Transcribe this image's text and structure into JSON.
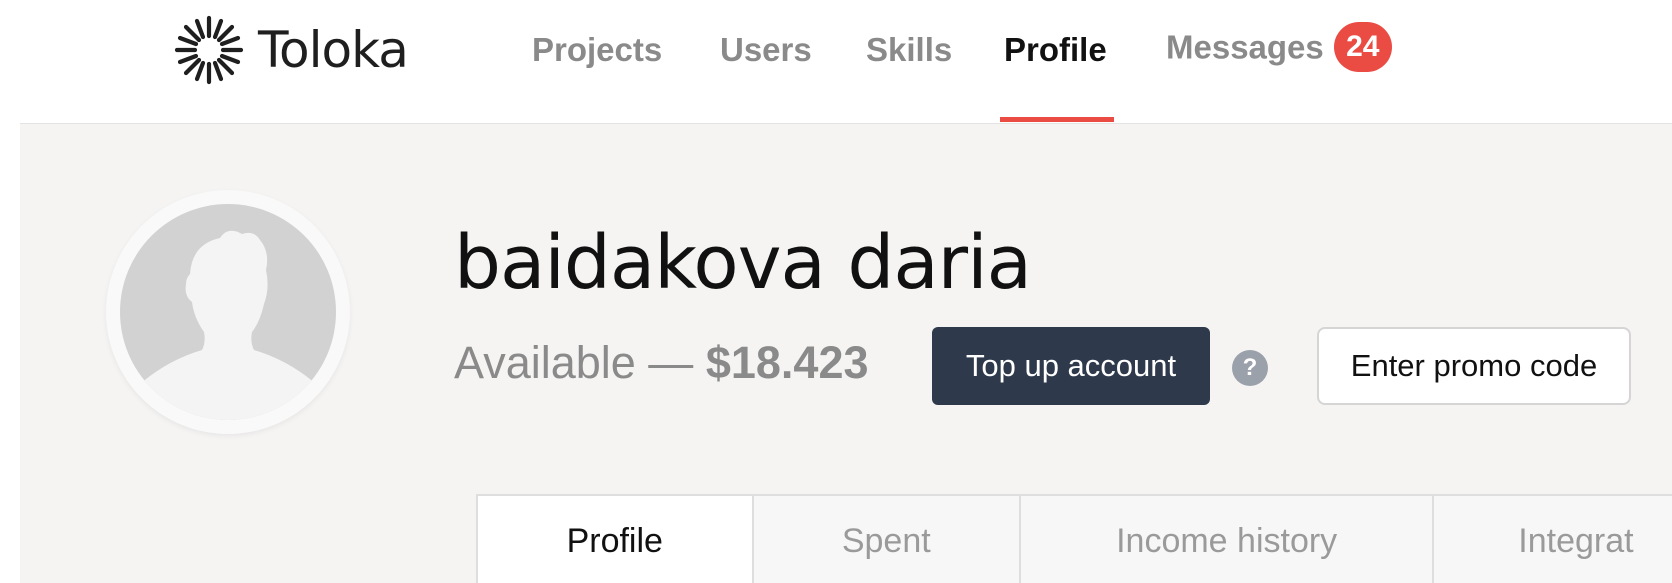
{
  "header": {
    "logo_text": "Toloka",
    "nav": [
      {
        "label": "Projects",
        "active": false
      },
      {
        "label": "Users",
        "active": false
      },
      {
        "label": "Skills",
        "active": false
      },
      {
        "label": "Profile",
        "active": true
      },
      {
        "label": "Messages",
        "active": false,
        "badge": "24"
      }
    ]
  },
  "profile": {
    "name": "baidakova daria",
    "balance_label": "Available —",
    "balance_amount": "$18.423",
    "topup_label": "Top up account",
    "help_glyph": "?",
    "promo_label": "Enter promo code"
  },
  "tabs": [
    {
      "label": "Profile",
      "active": true
    },
    {
      "label": "Spent",
      "active": false
    },
    {
      "label": "Income history",
      "active": false
    },
    {
      "label": "Integrat",
      "active": false
    }
  ],
  "colors": {
    "accent": "#ea4b43",
    "primary_button": "#2e3a4b",
    "background": "#f5f4f3"
  },
  "icons": {
    "logo": "starburst-logo-icon",
    "avatar": "user-silhouette-icon",
    "help": "question-circle-icon"
  }
}
